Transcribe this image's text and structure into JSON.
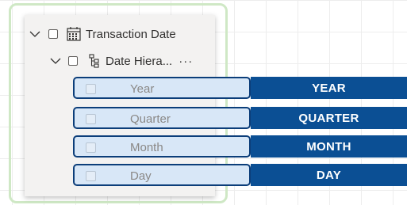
{
  "tree": {
    "root_label": "Transaction Date",
    "hierarchy_label": "Date Hiera...",
    "more_label": "···",
    "root_icon": "calendar-icon",
    "hierarchy_icon": "hierarchy-icon"
  },
  "fields": [
    {
      "label": "Year",
      "tag": "YEAR"
    },
    {
      "label": "Quarter",
      "tag": "QUARTER"
    },
    {
      "label": "Month",
      "tag": "MONTH"
    },
    {
      "label": "Day",
      "tag": "DAY"
    }
  ],
  "colors": {
    "accent": "#0b4f94",
    "row_fill": "#d8e7f7",
    "outline": "#0c3e7a",
    "frame": "#cfe8c5"
  }
}
